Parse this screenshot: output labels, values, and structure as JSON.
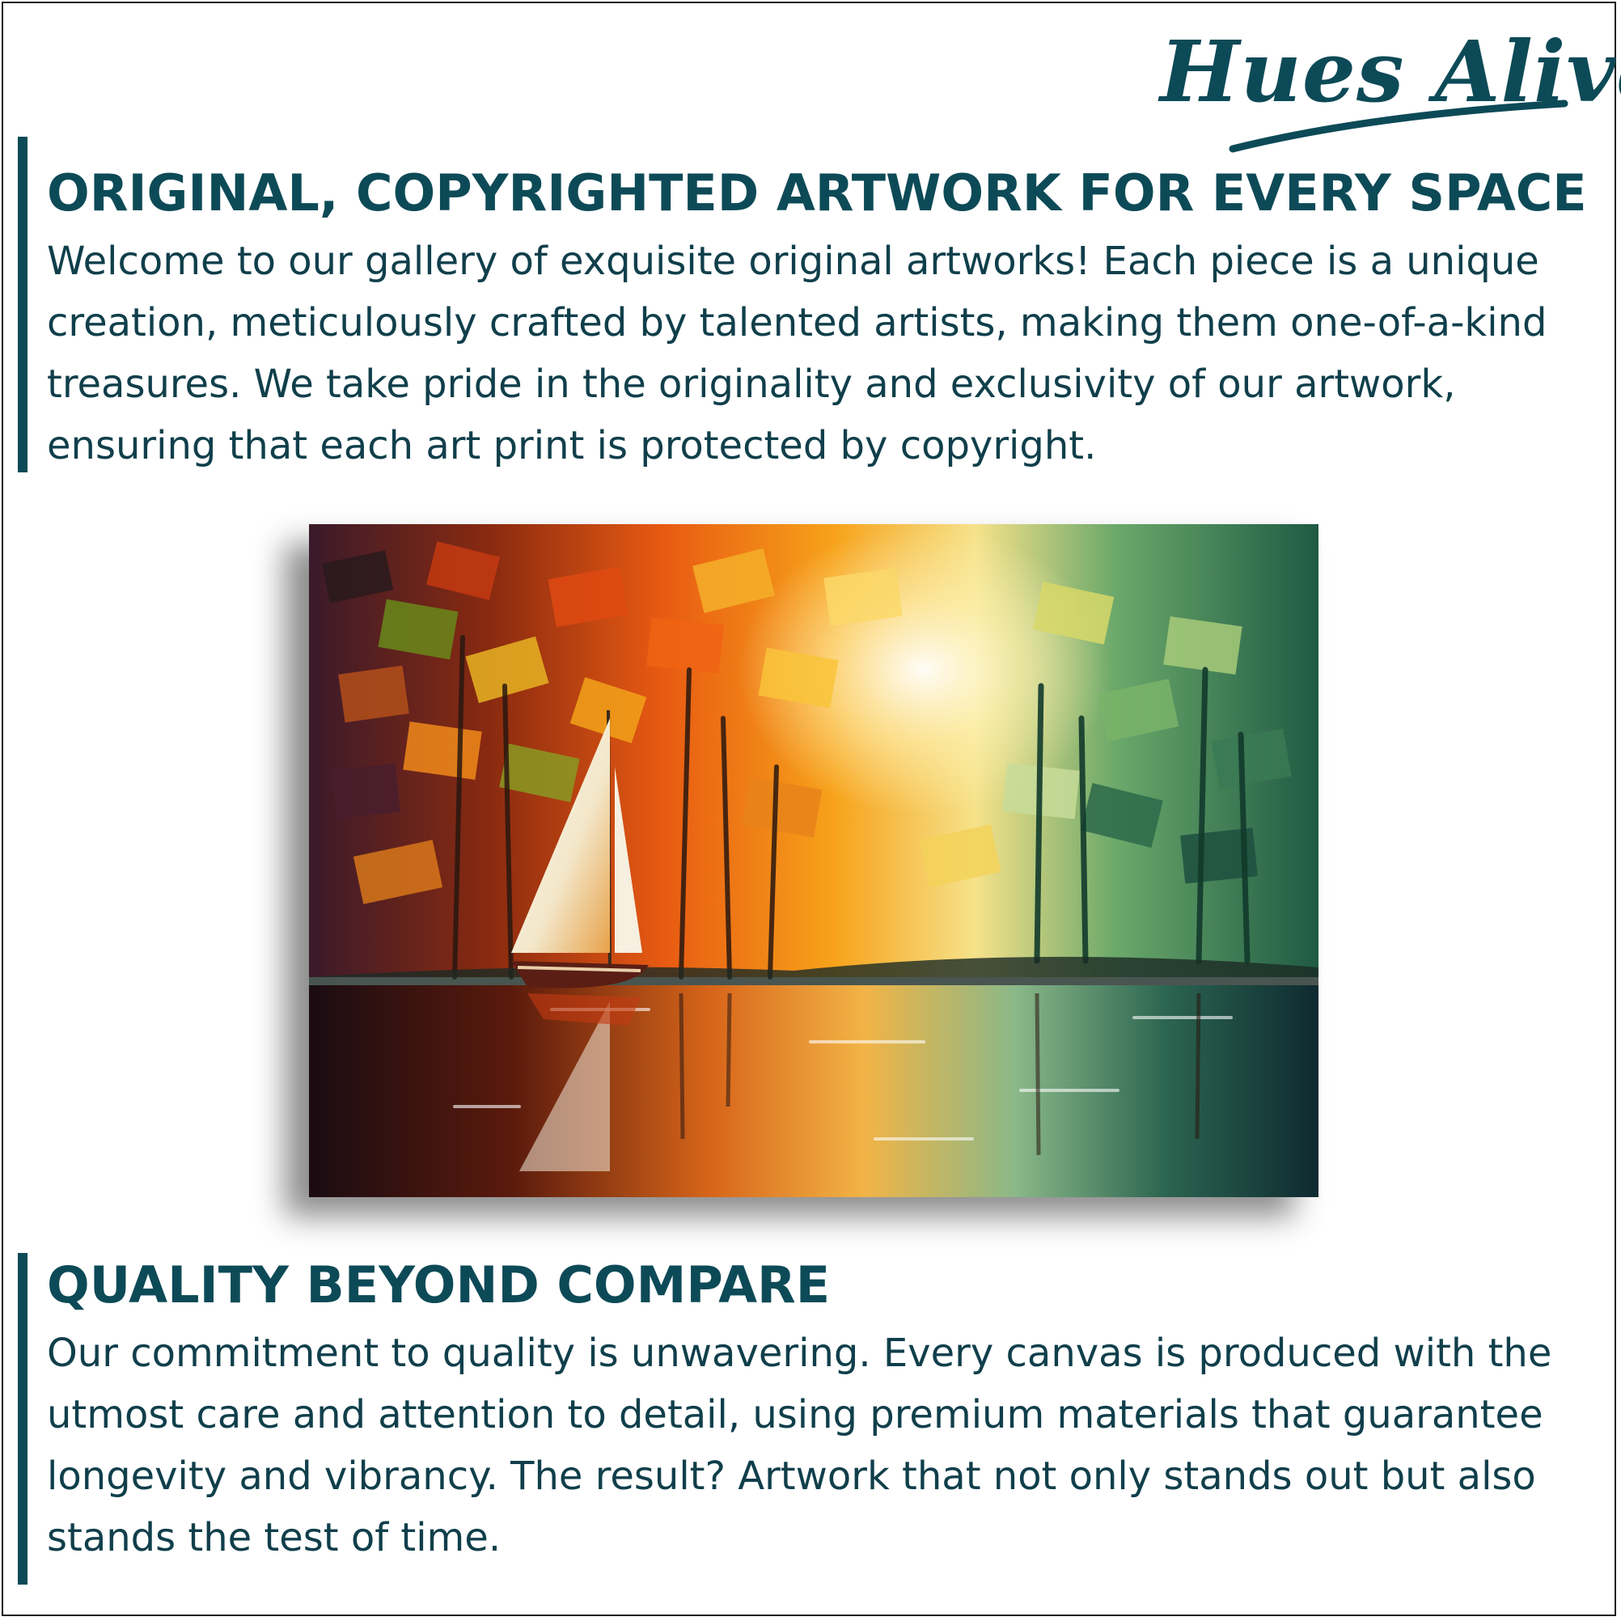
{
  "brand": {
    "logo_text": "Hues Alive"
  },
  "sections": [
    {
      "heading": "ORIGINAL, COPYRIGHTED ARTWORK FOR EVERY SPACE",
      "body": "Welcome to our gallery of exquisite original artworks! Each piece is a unique creation, meticulously crafted by talented artists, making them one-of-a-kind treasures. We take pride in the originality and exclusivity of our artwork, ensuring that each art print is protected by copyright."
    },
    {
      "heading": "QUALITY BEYOND COMPARE",
      "body": "Our commitment to quality is unwavering. Every canvas is produced with the utmost care and attention to detail, using premium materials that guarantee longevity and vibrancy. The result? Artwork that not only stands out but also stands the test of time."
    }
  ],
  "artwork": {
    "subject": "painting of a sailboat on a lake with autumn trees at sunset"
  },
  "colors": {
    "brand_teal": "#0d4a57",
    "text": "#103f4b",
    "background": "#ffffff"
  }
}
